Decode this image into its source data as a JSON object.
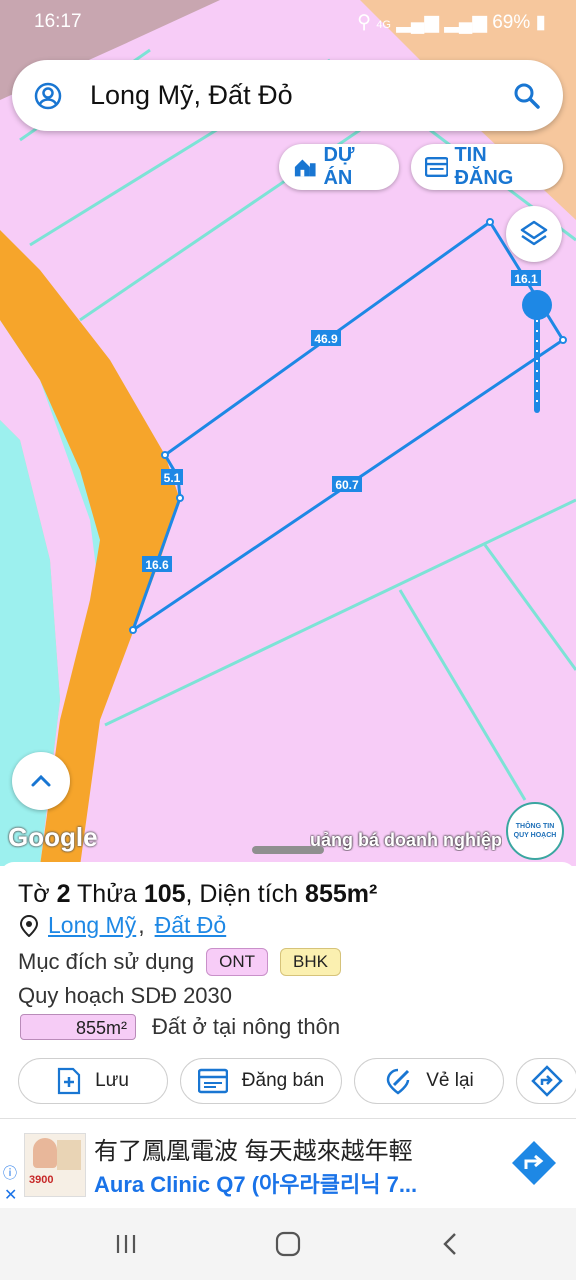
{
  "status_bar": {
    "time": "16:17",
    "battery": "69%",
    "network": "4G"
  },
  "search": {
    "query": "Long Mỹ, Đất Đỏ"
  },
  "top_buttons": {
    "projects_label": "DỰ ÁN",
    "listings_label": "TIN ĐĂNG"
  },
  "map": {
    "edge_labels": [
      "16.1",
      "46.9",
      "5.1",
      "60.7",
      "16.6"
    ],
    "attribution": "Google",
    "ticker": "uảng bá doanh nghiệp",
    "planning_badge": {
      "line1": "THÔNG TIN",
      "line2": "QUY HOẠCH"
    }
  },
  "parcel": {
    "sheet_prefix": "Tờ",
    "sheet_no": "2",
    "plot_prefix": "Thửa",
    "plot_no": "105",
    "area_prefix": ", Diện tích",
    "area": "855m²",
    "location_commune": "Long Mỹ",
    "location_district": "Đất Đỏ",
    "purpose_label": "Mục đích sử dụng",
    "purpose_codes": [
      "ONT",
      "BHK"
    ],
    "plan_label": "Quy hoạch SDĐ 2030",
    "plan_area": "855m²",
    "plan_use": "Đất ở tại nông thôn"
  },
  "actions": {
    "save": "Lưu",
    "post": "Đăng bán",
    "redraw": "Vẻ lại"
  },
  "ad": {
    "line1": "有了鳳凰電波 每天越來越年輕",
    "line2": "Aura Clinic Q7 (아우라클리닉 7...",
    "thumb_text": "3900"
  },
  "colors": {
    "map_pink": "#f7ccf7",
    "road_orange": "#f6a52b",
    "river_cyan": "#9cf0ee",
    "land_peach": "#f6c79d",
    "boundary_blue": "#1e88e5",
    "badge_ont": "#f7ccf7",
    "badge_bhk": "#fbf0b0"
  }
}
